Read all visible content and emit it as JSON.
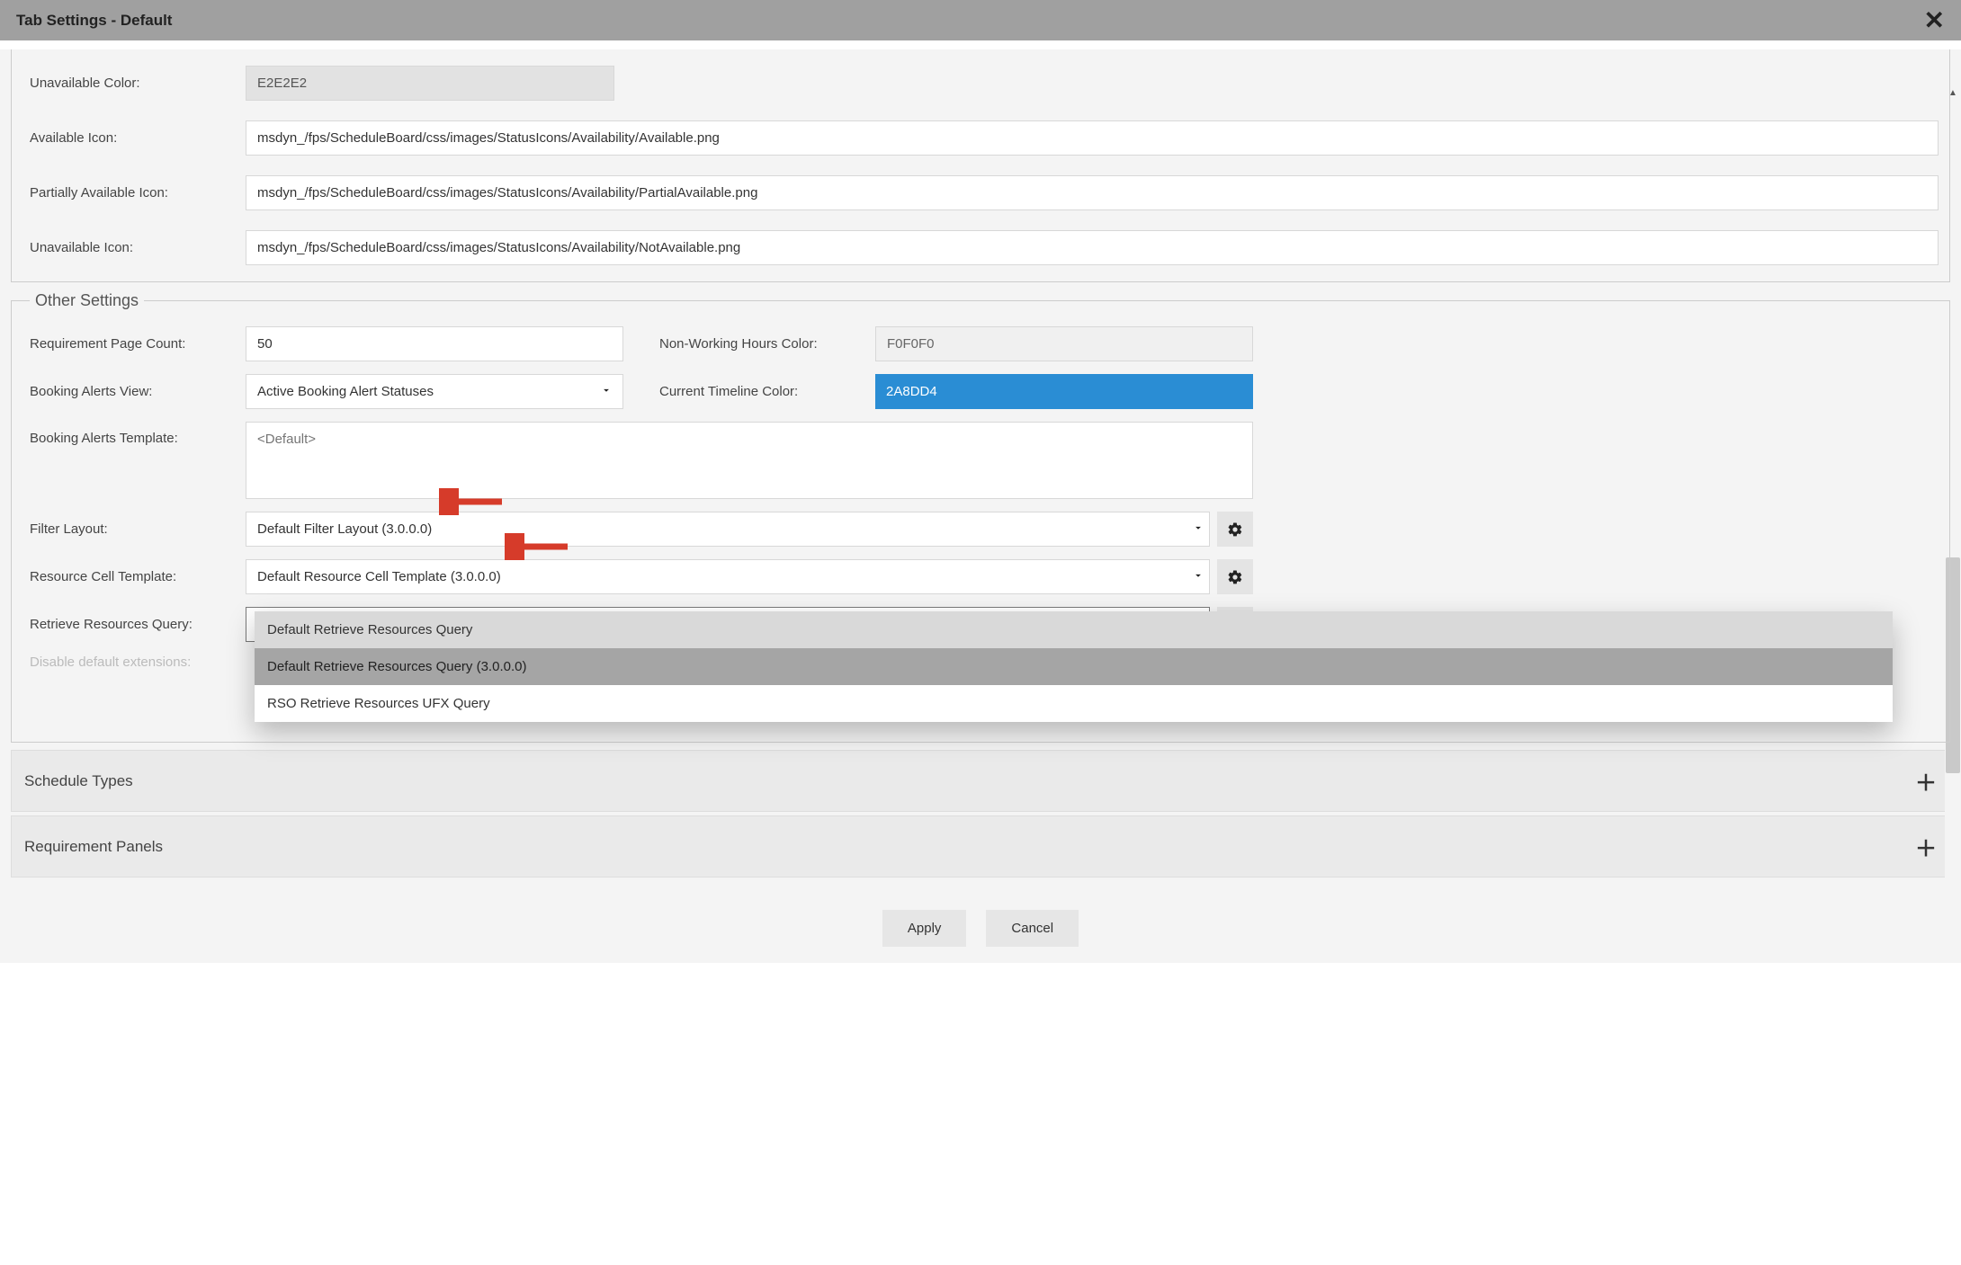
{
  "title": "Tab Settings - Default",
  "top_fields": {
    "unavailable_color": {
      "label": "Unavailable Color:",
      "value": "E2E2E2"
    },
    "available_icon": {
      "label": "Available Icon:",
      "value": "msdyn_/fps/ScheduleBoard/css/images/StatusIcons/Availability/Available.png"
    },
    "partially_available_icon": {
      "label": "Partially Available Icon:",
      "value": "msdyn_/fps/ScheduleBoard/css/images/StatusIcons/Availability/PartialAvailable.png"
    },
    "unavailable_icon": {
      "label": "Unavailable Icon:",
      "value": "msdyn_/fps/ScheduleBoard/css/images/StatusIcons/Availability/NotAvailable.png"
    }
  },
  "other_settings": {
    "legend": "Other Settings",
    "requirement_page_count": {
      "label": "Requirement Page Count:",
      "value": "50"
    },
    "non_working_hours_color": {
      "label": "Non-Working Hours Color:",
      "value": "F0F0F0"
    },
    "booking_alerts_view": {
      "label": "Booking Alerts View:",
      "value": "Active Booking Alert Statuses"
    },
    "current_timeline_color": {
      "label": "Current Timeline Color:",
      "value": "2A8DD4"
    },
    "booking_alerts_template": {
      "label": "Booking Alerts Template:",
      "placeholder": "<Default>"
    },
    "filter_layout": {
      "label": "Filter Layout:",
      "value": "Default Filter Layout (3.0.0.0)"
    },
    "resource_cell_template": {
      "label": "Resource Cell Template:",
      "value": "Default Resource Cell Template (3.0.0.0)"
    },
    "retrieve_resources_query": {
      "label": "Retrieve Resources Query:",
      "value": "Default Retrieve Resources Query",
      "options": [
        "Default Retrieve Resources Query",
        "Default Retrieve Resources Query (3.0.0.0)",
        "RSO Retrieve Resources UFX Query"
      ]
    },
    "disable_default_extensions": {
      "label": "Disable default extensions:"
    }
  },
  "accordions": {
    "schedule_types": "Schedule Types",
    "requirement_panels": "Requirement Panels"
  },
  "footer": {
    "apply": "Apply",
    "cancel": "Cancel"
  }
}
